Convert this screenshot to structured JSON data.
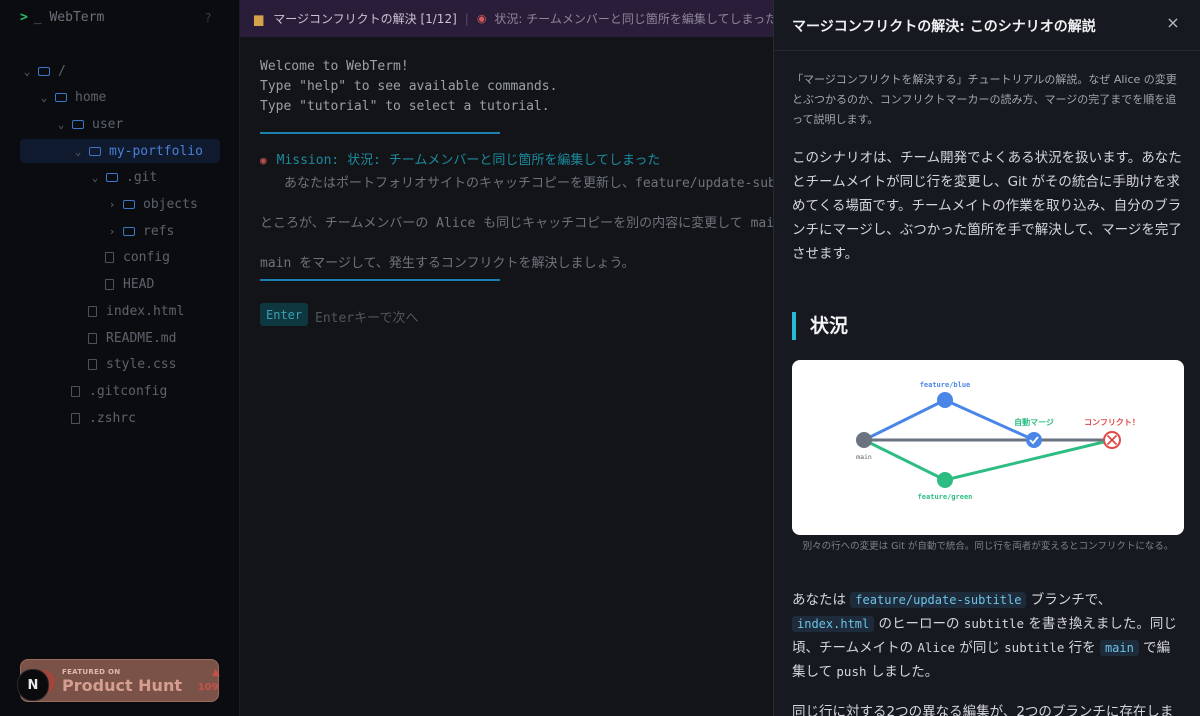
{
  "sidebar": {
    "brand": "_ WebTerm",
    "brand_prompt": ">",
    "help": "?",
    "tree": [
      {
        "label": "/",
        "type": "folder",
        "depth": 0,
        "expanded": true
      },
      {
        "label": "home",
        "type": "folder",
        "depth": 1,
        "expanded": true
      },
      {
        "label": "user",
        "type": "folder",
        "depth": 2,
        "expanded": true
      },
      {
        "label": "my-portfolio",
        "type": "folder",
        "depth": 3,
        "expanded": true,
        "active": true
      },
      {
        "label": ".git",
        "type": "folder",
        "depth": 4,
        "expanded": true
      },
      {
        "label": "objects",
        "type": "folder",
        "depth": 5,
        "expanded": false
      },
      {
        "label": "refs",
        "type": "folder",
        "depth": 5,
        "expanded": false
      },
      {
        "label": "config",
        "type": "file",
        "depth": 5
      },
      {
        "label": "HEAD",
        "type": "file",
        "depth": 5
      },
      {
        "label": "index.html",
        "type": "file",
        "depth": 4
      },
      {
        "label": "README.md",
        "type": "file",
        "depth": 4
      },
      {
        "label": "style.css",
        "type": "file",
        "depth": 4
      },
      {
        "label": ".gitconfig",
        "type": "file",
        "depth": 3
      },
      {
        "label": ".zshrc",
        "type": "file",
        "depth": 3
      }
    ],
    "badge": {
      "featured": "FEATURED ON",
      "name": "Product Hunt",
      "count": "109"
    },
    "avatar": "N"
  },
  "terminal": {
    "header_title": "マージコンフリクトの解決 [1/12]",
    "header_status": "状況: チームメンバーと同じ箇所を編集してしまった",
    "lines": [
      "Welcome to WebTerm!",
      "Type \"help\" to see available commands.",
      "Type \"tutorial\" to select a tutorial."
    ],
    "mission": "Mission: 状況: チームメンバーと同じ箇所を編集してしまった",
    "mission_desc": "あなたはポートフォリオサイトのキャッチコピーを更新し、feature/update-subtitle",
    "line_alice": "ところが、チームメンバーの Alice も同じキャッチコピーを別の内容に変更して main",
    "line_merge": "main をマージして、発生するコンフリクトを解決しましょう。",
    "enter_label": "Enter",
    "enter_hint": "Enterキーで次へ"
  },
  "panel": {
    "title": "マージコンフリクトの解決: このシナリオの解説",
    "close": "×",
    "intro": "「マージコンフリクトを解決する」チュートリアルの解説。なぜ Alice の変更とぶつかるのか、コンフリクトマーカーの読み方、マージの完了までを順を追って説明します。",
    "para1": "このシナリオは、チーム開発でよくある状況を扱います。あなたとチームメイトが同じ行を変更し、Git がその統合に手助けを求めてくる場面です。チームメイトの作業を取り込み、自分のブランチにマージし、ぶつかった箇所を手で解決して、マージを完了させます。",
    "heading": "状況",
    "diagram": {
      "feature_blue": "feature/blue",
      "feature_green": "feature/green",
      "main": "main",
      "auto_merge": "自動マージ",
      "conflict": "コンフリクト！",
      "colors": {
        "blue": "#4a86e8",
        "green": "#2dbd83",
        "main": "#6b7280",
        "conflict": "#e04848"
      }
    },
    "caption": "別々の行への変更は Git が自動で統合。同じ行を両者が変えるとコンフリクトになる。",
    "para2": {
      "t1": "あなたは",
      "c1": "feature/update-subtitle",
      "t2": "ブランチで、",
      "c2": "index.html",
      "t3": "のヒーローの",
      "c3": "subtitle",
      "t4": "を書き換えました。同じ頃、チームメイトの",
      "c4": "Alice",
      "t5": "が同じ",
      "c5": "subtitle",
      "t6": "行を",
      "c6": "main",
      "t7": "で編集して",
      "c7": "push",
      "t8": "しました。"
    },
    "para3": "同じ行に対する2つの異なる編集が、2つのブランチに存在しま"
  }
}
